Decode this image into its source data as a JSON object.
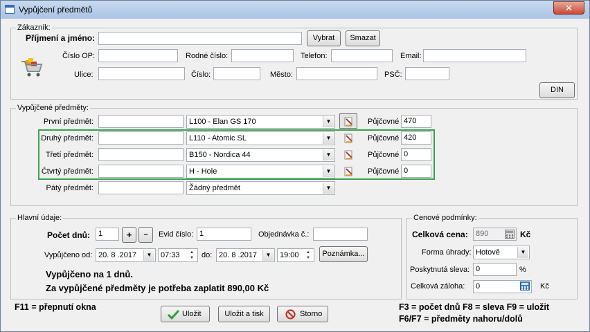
{
  "window": {
    "title": "Vypůjčení předmětů",
    "close_glyph": "✕"
  },
  "customer": {
    "legend": "Zákazník:",
    "name_label": "Příjmení a jméno:",
    "name_value": "",
    "select_btn": "Vybrat",
    "delete_btn": "Smazat",
    "op_label": "Číslo OP:",
    "birth_label": "Rodné číslo:",
    "phone_label": "Telefon:",
    "email_label": "Email:",
    "street_label": "Ulice:",
    "number_label": "Číslo:",
    "city_label": "Město:",
    "zip_label": "PSČ:",
    "din_btn": "DIN"
  },
  "items": {
    "legend": "Vypůjčené předměty:",
    "rent_label": "Půjčovné",
    "rows": [
      {
        "label": "První předmět:",
        "code": "",
        "selected": "L100 - Elan GS 170",
        "rent": "470"
      },
      {
        "label": "Druhý předmět:",
        "code": "",
        "selected": "L110 - Atomic SL",
        "rent": "420"
      },
      {
        "label": "Třetí předmět:",
        "code": "",
        "selected": "B150 - Nordica 44",
        "rent": "0"
      },
      {
        "label": "Čtvrtý předmět:",
        "code": "",
        "selected": "H - Hole",
        "rent": "0"
      },
      {
        "label": "Pátý předmět:",
        "code": "",
        "selected": "Žádný předmět"
      }
    ]
  },
  "main": {
    "legend": "Hlavní údaje:",
    "days_label": "Počet dnů:",
    "days_value": "1",
    "plus": "+",
    "minus": "–",
    "evid_label": "Evid číslo:",
    "evid_value": "1",
    "order_label": "Objednávka č.:",
    "order_value": "",
    "from_label": "Vypůjčeno od:",
    "from_date": "20. 8 .2017",
    "from_time": "07:33",
    "to_label": "do:",
    "to_date": "20. 8 .2017",
    "to_time": "19:00",
    "note_btn": "Poznámka...",
    "summary1": "Vypůjčeno na 1 dnů.",
    "summary2": "Za vypůjčené předměty je potřeba zaplatit 890,00 Kč"
  },
  "price": {
    "legend": "Cenové podmínky:",
    "total_label": "Celková cena:",
    "total_value": "890",
    "currency": "Kč",
    "payment_label": "Forma úhrady:",
    "payment_value": "Hotově",
    "discount_label": "Poskytnutá sleva:",
    "discount_value": "0",
    "percent": "%",
    "deposit_label": "Celková záloha:",
    "deposit_value": "0"
  },
  "footer": {
    "hint_left": "F11 = přepnutí okna",
    "hint_right1": "F3 = počet dnů  F8 = sleva  F9 = uložit",
    "hint_right2": "F6/F7 = předměty nahoru/dolů",
    "save_btn": "Uložit",
    "save_print_btn": "Uložit a tisk",
    "cancel_btn": "Storno"
  },
  "colors": {
    "highlight_box": "#3aa14d",
    "title_bar": "#a9c3e4",
    "close_button": "#c74a35"
  }
}
